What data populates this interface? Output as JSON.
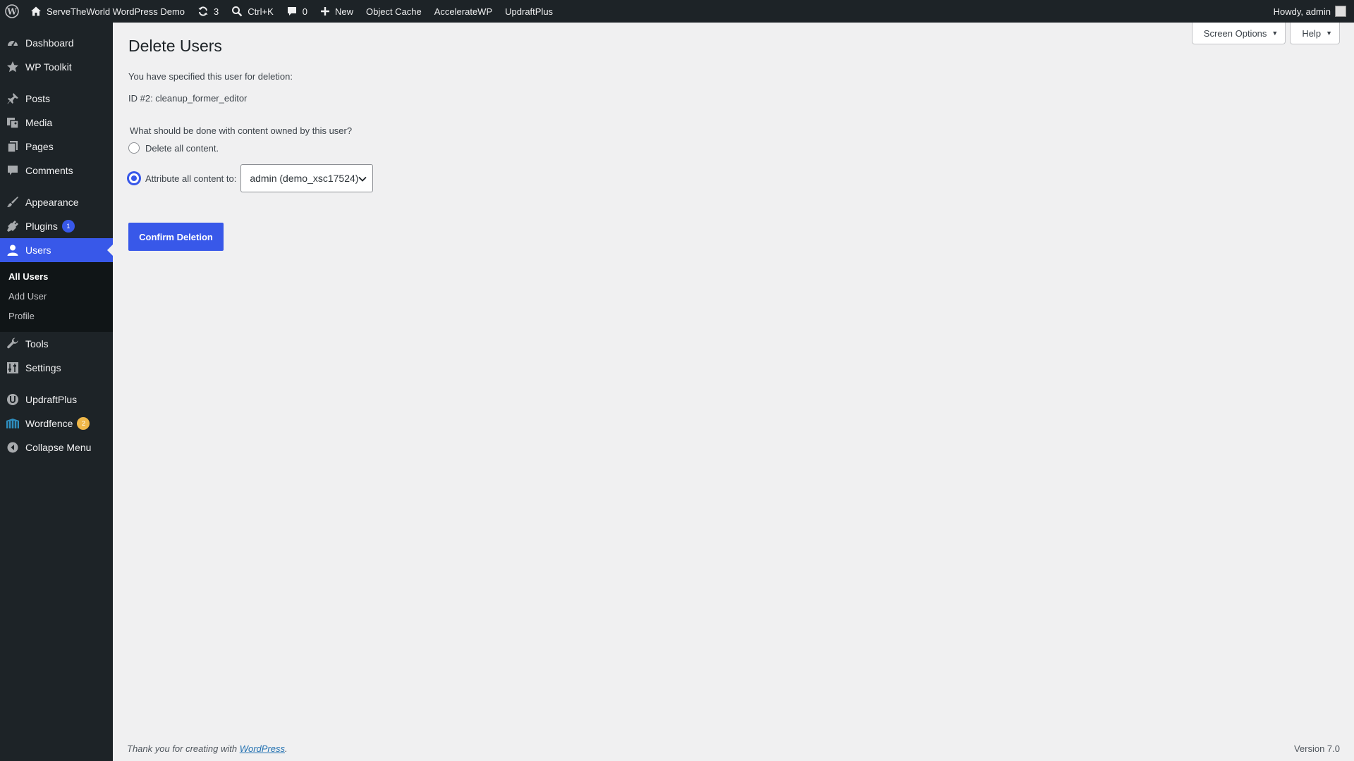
{
  "adminbar": {
    "site_name": "ServeTheWorld WordPress Demo",
    "updates_count": "3",
    "search_shortcut": "Ctrl+K",
    "comments_count": "0",
    "new_label": "New",
    "object_cache": "Object Cache",
    "accelerate": "AccelerateWP",
    "updraft": "UpdraftPlus",
    "howdy": "Howdy, admin"
  },
  "sidebar": {
    "dashboard": "Dashboard",
    "wp_toolkit": "WP Toolkit",
    "posts": "Posts",
    "media": "Media",
    "pages": "Pages",
    "comments": "Comments",
    "appearance": "Appearance",
    "plugins": "Plugins",
    "plugins_badge": "1",
    "users": "Users",
    "submenu": {
      "all_users": "All Users",
      "add_user": "Add User",
      "profile": "Profile"
    },
    "tools": "Tools",
    "settings": "Settings",
    "updraftplus": "UpdraftPlus",
    "wordfence": "Wordfence",
    "wordfence_badge": "2",
    "collapse": "Collapse Menu"
  },
  "screen_meta": {
    "screen_options": "Screen Options",
    "help": "Help"
  },
  "main": {
    "title": "Delete Users",
    "specified_text": "You have specified this user for deletion:",
    "user_line": "ID #2: cleanup_former_editor",
    "question": "What should be done with content owned by this user?",
    "option_delete": "Delete all content.",
    "option_attribute": "Attribute all content to:",
    "selected_option": "Attribute all content to:",
    "attribute_select_value": "admin (demo_xsc17524)",
    "confirm_button": "Confirm Deletion"
  },
  "footer": {
    "thanks_prefix": "Thank you for creating with ",
    "thanks_link": "WordPress",
    "thanks_suffix": ".",
    "version": "Version 7.0"
  },
  "colors": {
    "accent": "#3858e9",
    "sidebar_bg": "#1d2327",
    "page_bg": "#f0f0f1",
    "badge_orange": "#f0b849"
  }
}
